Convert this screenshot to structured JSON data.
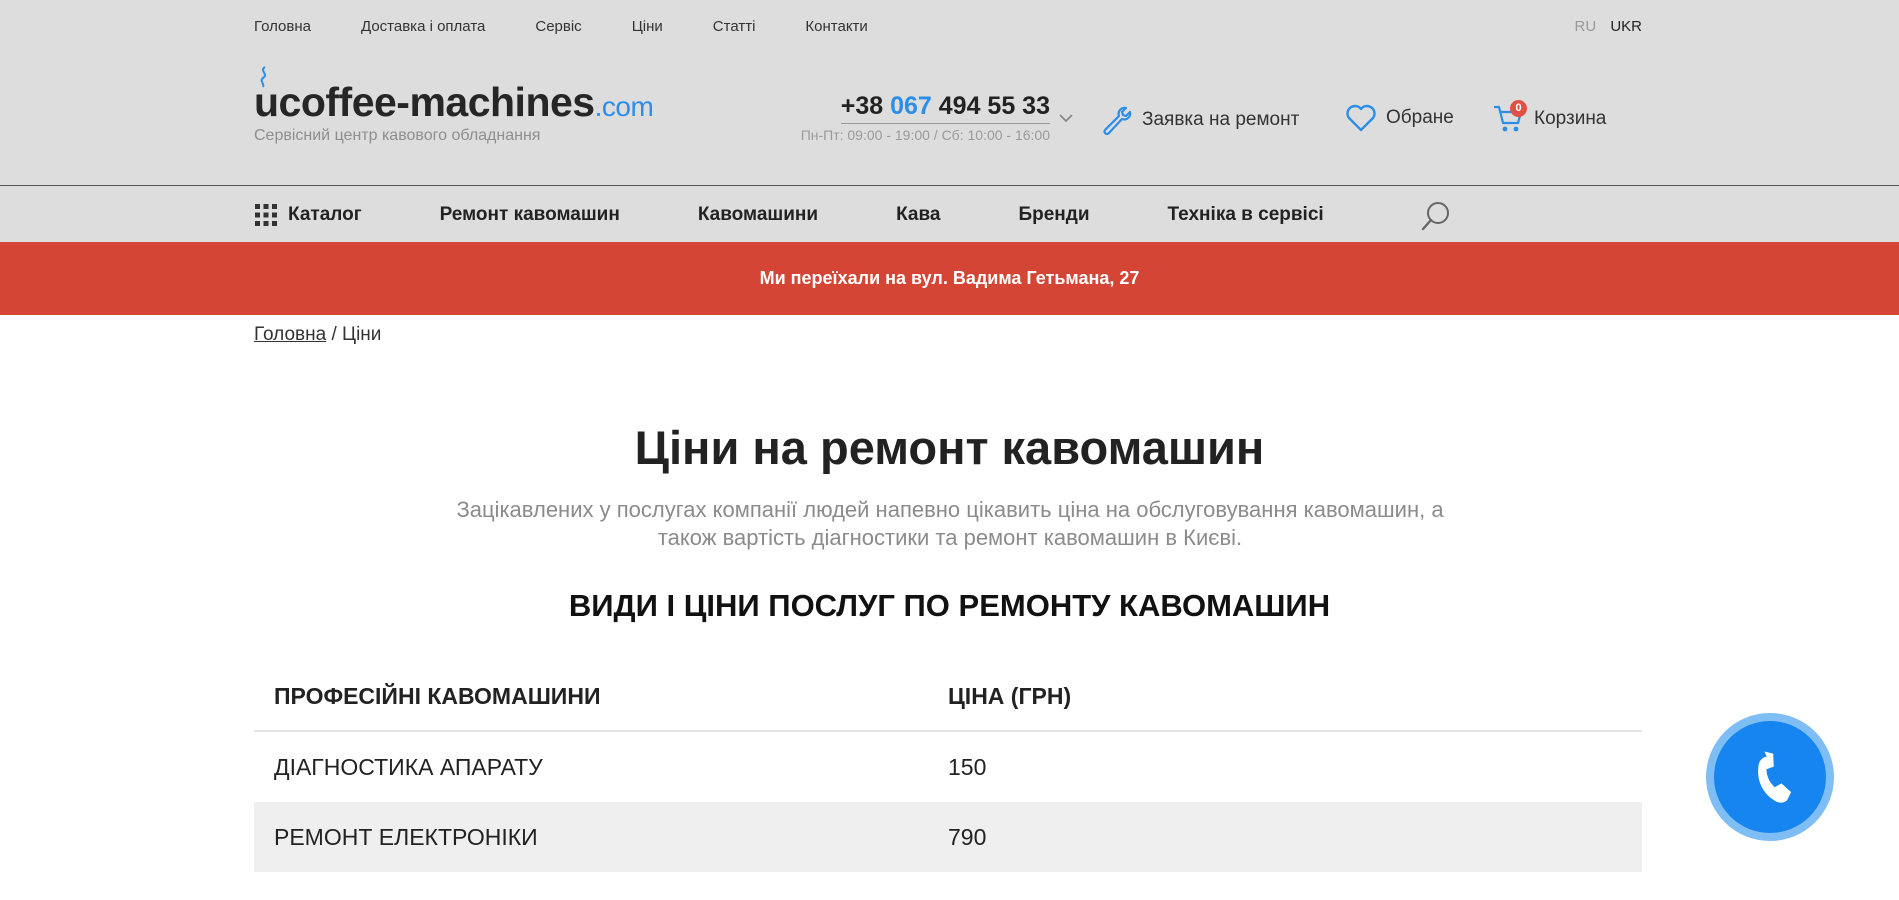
{
  "topnav": {
    "items": [
      "Головна",
      "Доставка і оплата",
      "Сервіс",
      "Ціни",
      "Статті",
      "Контакти"
    ],
    "lang_ru": "RU",
    "lang_ukr": "UKR"
  },
  "logo": {
    "main": "ucoffee-machines",
    "domain": ".com",
    "tagline": "Сервісний центр кавового обладнання"
  },
  "contact": {
    "phone_prefix": "+38 ",
    "phone_code": "067",
    "phone_number": " 494 55 33",
    "hours": "Пн-Пт: 09:00 - 19:00 / Сб: 10:00 - 16:00"
  },
  "actions": {
    "repair": "Заявка на ремонт",
    "favorites": "Обране",
    "cart": "Корзина",
    "cart_count": "0"
  },
  "catnav": {
    "items": [
      "Каталог",
      "Ремонт кавомашин",
      "Кавомашини",
      "Кава",
      "Бренди",
      "Техніка в сервісі"
    ]
  },
  "banner": {
    "text": "Ми переїхали на вул. Вадима Гетьмана, 27"
  },
  "breadcrumb": {
    "home": "Головна",
    "separator": " / ",
    "current": "Ціни"
  },
  "main": {
    "title": "Ціни на ремонт кавомашин",
    "intro": "Зацікавлених у послугах компанії людей напевно цікавить ціна на обслуговування кавомашин, а також вартість діагностики та ремонт кавомашин в Києві.",
    "section_title": "ВИДИ І ЦІНИ ПОСЛУГ ПО РЕМОНТУ КАВОМАШИН"
  },
  "price_table": {
    "headers": [
      "ПРОФЕСІЙНІ КАВОМАШИНИ",
      "ЦІНА (ГРН)"
    ],
    "rows": [
      {
        "service": "ДІАГНОСТИКА АПАРАТУ",
        "price": "150"
      },
      {
        "service": "РЕМОНТ ЕЛЕКТРОНІКИ",
        "price": "790"
      }
    ]
  },
  "colors": {
    "accent": "#2b8ee8",
    "banner": "#d44535",
    "header_bg": "#dedddd",
    "call_button": "#1685ef"
  }
}
